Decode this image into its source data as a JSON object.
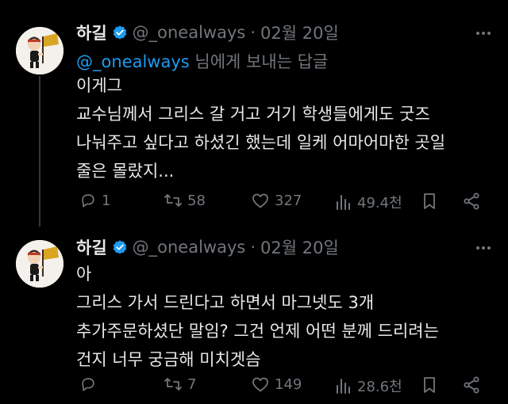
{
  "tweets": [
    {
      "author_name": "하길",
      "handle": "@_onealways",
      "separator": "·",
      "date": "02월 20일",
      "reply_to": {
        "mention": "@_onealways",
        "suffix": " 님에게 보내는 답글"
      },
      "text": "이게그\n교수님께서 그리스 갈 거고 거기 학생들에게도 굿즈\n나눠주고 싶다고 하셨긴 했는데 일케 어마어마한 곳일\n줄은 몰랐지...",
      "actions": {
        "replies": "1",
        "reposts": "58",
        "likes": "327",
        "views": "49.4천"
      }
    },
    {
      "author_name": "하길",
      "handle": "@_onealways",
      "separator": "·",
      "date": "02월 20일",
      "text": "아\n그리스 가서 드린다고 하면서 마그넷도 3개\n추가주문하셨단 말임? 그건 언제 어떤 분께 드리려는\n건지 너무 궁금해 미치겟슴",
      "actions": {
        "replies": "",
        "reposts": "7",
        "likes": "149",
        "views": "28.6천"
      }
    }
  ],
  "colors": {
    "background": "#000000",
    "text": "#e7e9ea",
    "muted": "#71767b",
    "accent": "#1d9bf0"
  },
  "icons": [
    "avatar-image",
    "verified-badge-icon",
    "more-icon",
    "reply-icon",
    "repost-icon",
    "like-icon",
    "views-icon",
    "bookmark-icon",
    "share-icon"
  ]
}
